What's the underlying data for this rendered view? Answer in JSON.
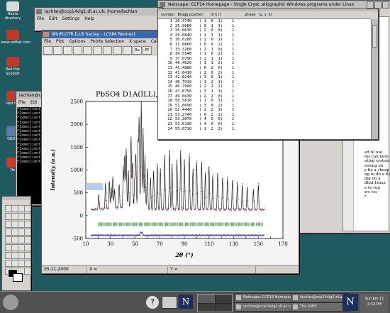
{
  "desktop": {
    "icons": [
      {
        "label": "Home directory",
        "color": "#d9d9d9",
        "glyph": "home-icon"
      },
      {
        "label": "www.redhat.com",
        "color": "#c0392b",
        "glyph": "redhat-web-icon"
      },
      {
        "label": "Red Hat Support",
        "color": "#c0392b",
        "glyph": "redhat-support-icon"
      },
      {
        "label": "Red Ha",
        "color": "#c0392b",
        "glyph": "redhat-icon"
      },
      {
        "label": "GNOM",
        "color": "#5a7ca8",
        "glyph": "gnome-icon"
      },
      {
        "label": "Ro",
        "color": "#cf3a2a",
        "glyph": "ro-icon"
      }
    ]
  },
  "terminal_top": {
    "title": "lachlan@ccp14vlg1.dl.ac.uk: /home/lachlan",
    "menus": [
      "File",
      "Edit",
      "Settings",
      "Help"
    ]
  },
  "terminal_left": {
    "title": "lachlan@cc",
    "menus": [
      "File",
      "Edi"
    ],
    "lines": [
      "F1xmeclient3rd",
      "F1xmeclient3rd",
      "F1xmeclient3rd",
      "F1xmeclient3rd",
      "F1xmeclient3rd",
      "F1xmeclient3rd",
      "F1xmeclient3rd",
      "F1xmeclient3rd",
      "F1xmeclient3rd",
      "F1xmeclient3rd",
      "F1xmeclient3rd",
      "F1xmeclient3rd",
      "F1xmeclient3rd"
    ]
  },
  "winplotr": {
    "title": "WinPLOTR [LLB Saclay - LCSIM Rennes]",
    "menus": [
      "File",
      "Plot",
      "Options",
      "Points Selection",
      "X space",
      "Calculato"
    ],
    "toolbar": [
      "",
      "",
      "",
      "",
      "",
      "",
      "",
      "",
      "",
      "Ru",
      "FF"
    ],
    "status": {
      "date": "05-11-2000",
      "x_label": "X =",
      "y_label": "Y ="
    }
  },
  "netscape": {
    "title": "Netscape: CCP14 Homepage - Single Cryst..allographic Windows programs under Linux",
    "menus": [
      "File",
      "Edit",
      "View",
      "Go",
      "Communicator"
    ],
    "text_lines": [
      "ed to use",
      "ms can here",
      "ating system.",
      "essing on",
      "",
      "y be a cheap",
      "ng to do a full",
      "ing on a",
      "dhat Linux",
      "e to run",
      "",
      "ws via",
      "r"
    ]
  },
  "reflections": {
    "header": [
      "number",
      "Bragg position",
      "(h k l)",
      "phase",
      "(u, v, k)"
    ],
    "rows": [
      [
        "1",
        "20.4740",
        "( 1  0  1)",
        "1"
      ],
      [
        "2",
        "25.9080",
        "( 0  1  1)",
        "1"
      ],
      [
        "3",
        "26.0630",
        "( 2  0  0)",
        "1"
      ],
      [
        "4",
        "29.0840",
        "( 1  1  1)",
        "1"
      ],
      [
        "5",
        "30.6200",
        "( 2  0  1)",
        "1"
      ],
      [
        "6",
        "31.8860",
        "( 0  0  2)",
        "1"
      ],
      [
        "7",
        "33.3260",
        "( 2  1  0)",
        "1"
      ],
      [
        "8",
        "34.5540",
        "( 1  0  2)",
        "1"
      ],
      [
        "9",
        "37.0790",
        "( 2  1  1)",
        "1"
      ],
      [
        "10",
        "40.4620",
        "( 1  1  2)",
        "1"
      ],
      [
        "11",
        "41.4880",
        "( 0  2  0)",
        "1"
      ],
      [
        "12",
        "41.6410",
        "( 2  0  2)",
        "1"
      ],
      [
        "13",
        "42.8240",
        "( 3  0  1)",
        "1"
      ],
      [
        "14",
        "46.7010",
        "( 1  2  1)",
        "1"
      ],
      [
        "15",
        "46.7990",
        "( 2  1  2)",
        "1"
      ],
      [
        "16",
        "47.8750",
        "( 3  1  1)",
        "1"
      ],
      [
        "17",
        "49.6630",
        "( 2  2  0)",
        "1"
      ],
      [
        "18",
        "50.5810",
        "( 1  0  3)",
        "1"
      ],
      [
        "19",
        "51.6690",
        "( 3  0  2)",
        "1"
      ],
      [
        "20",
        "52.4440",
        "( 2  2  1)",
        "1"
      ],
      [
        "21",
        "53.2740",
        "( 0  2  2)",
        "1"
      ],
      [
        "22",
        "53.3070",
        "( 4  0  0)",
        "1"
      ],
      [
        "23",
        "53.6130",
        "( 4  0  0)",
        "1"
      ],
      [
        "24",
        "55.0710",
        "( 1  2  2)",
        "1"
      ]
    ]
  },
  "gimp": {
    "title": "The GIMP"
  },
  "taskbar": {
    "items": [
      "Netscape: CCP14 Homepage - Sin...",
      "lachlan@ccp14vlg1.dl.ac.uk: /home/",
      "lachlan@ccp14vlg1.dl.ac.uk: /home/",
      "lachlan@ccp14vlg1.dl.ac.uk: /h/lfp/",
      "lachlan@ccp14vlg1.dl.ac.uk: /home/",
      "The GIMP"
    ],
    "clock_date": "Sun Jan 11",
    "clock_time": "2:33 PM"
  },
  "chart_data": {
    "type": "line",
    "title": "PbSO4 D1A(ILL),Ri",
    "xlabel": "2θ (°)",
    "ylabel": "Intensity (a.u.)",
    "xlim": [
      10,
      170
    ],
    "ylim": [
      -500,
      2500
    ],
    "xticks": [
      "10",
      "20",
      "30",
      "40",
      "50",
      "60",
      "70",
      "80",
      "90",
      "100",
      "110",
      "120",
      "130",
      "140",
      "150",
      "160",
      "170"
    ],
    "yticks": [
      "-500",
      "0",
      "500",
      "1000",
      "1500",
      "2000",
      "2500"
    ],
    "series": [],
    "peaks": [
      [
        20.5,
        320
      ],
      [
        26.0,
        560
      ],
      [
        29.1,
        620
      ],
      [
        30.6,
        480
      ],
      [
        31.9,
        700
      ],
      [
        33.3,
        420
      ],
      [
        37.1,
        520
      ],
      [
        40.5,
        900
      ],
      [
        41.6,
        1150
      ],
      [
        42.8,
        1300
      ],
      [
        44.5,
        800
      ],
      [
        46.7,
        1550
      ],
      [
        47.9,
        1000
      ],
      [
        49.7,
        600
      ],
      [
        50.6,
        1150
      ],
      [
        52.4,
        1400
      ],
      [
        53.3,
        1900
      ],
      [
        55.0,
        2300
      ],
      [
        56.5,
        1700
      ],
      [
        58.0,
        1100
      ],
      [
        60.0,
        900
      ],
      [
        62.5,
        700
      ],
      [
        65.0,
        850
      ],
      [
        68.0,
        1000
      ],
      [
        70.5,
        900
      ],
      [
        74.0,
        1200
      ],
      [
        78.0,
        1300
      ],
      [
        80.0,
        1000
      ],
      [
        84.0,
        1100
      ],
      [
        87.0,
        1300
      ],
      [
        90.0,
        1100
      ],
      [
        94.0,
        1200
      ],
      [
        97.0,
        900
      ],
      [
        100.0,
        1050
      ],
      [
        104.0,
        1050
      ],
      [
        107.0,
        800
      ],
      [
        110.0,
        950
      ],
      [
        113.0,
        750
      ],
      [
        117.0,
        800
      ],
      [
        121.0,
        700
      ],
      [
        125.0,
        700
      ],
      [
        129.0,
        650
      ],
      [
        133.0,
        600
      ],
      [
        137.0,
        550
      ],
      [
        141.0,
        500
      ],
      [
        146.0,
        450
      ],
      [
        150.0,
        550
      ]
    ],
    "colors": {
      "observed": "#8b0000",
      "calculated": "#000000",
      "bragg": "#2e8b2e",
      "difference": "#0000cd"
    }
  }
}
